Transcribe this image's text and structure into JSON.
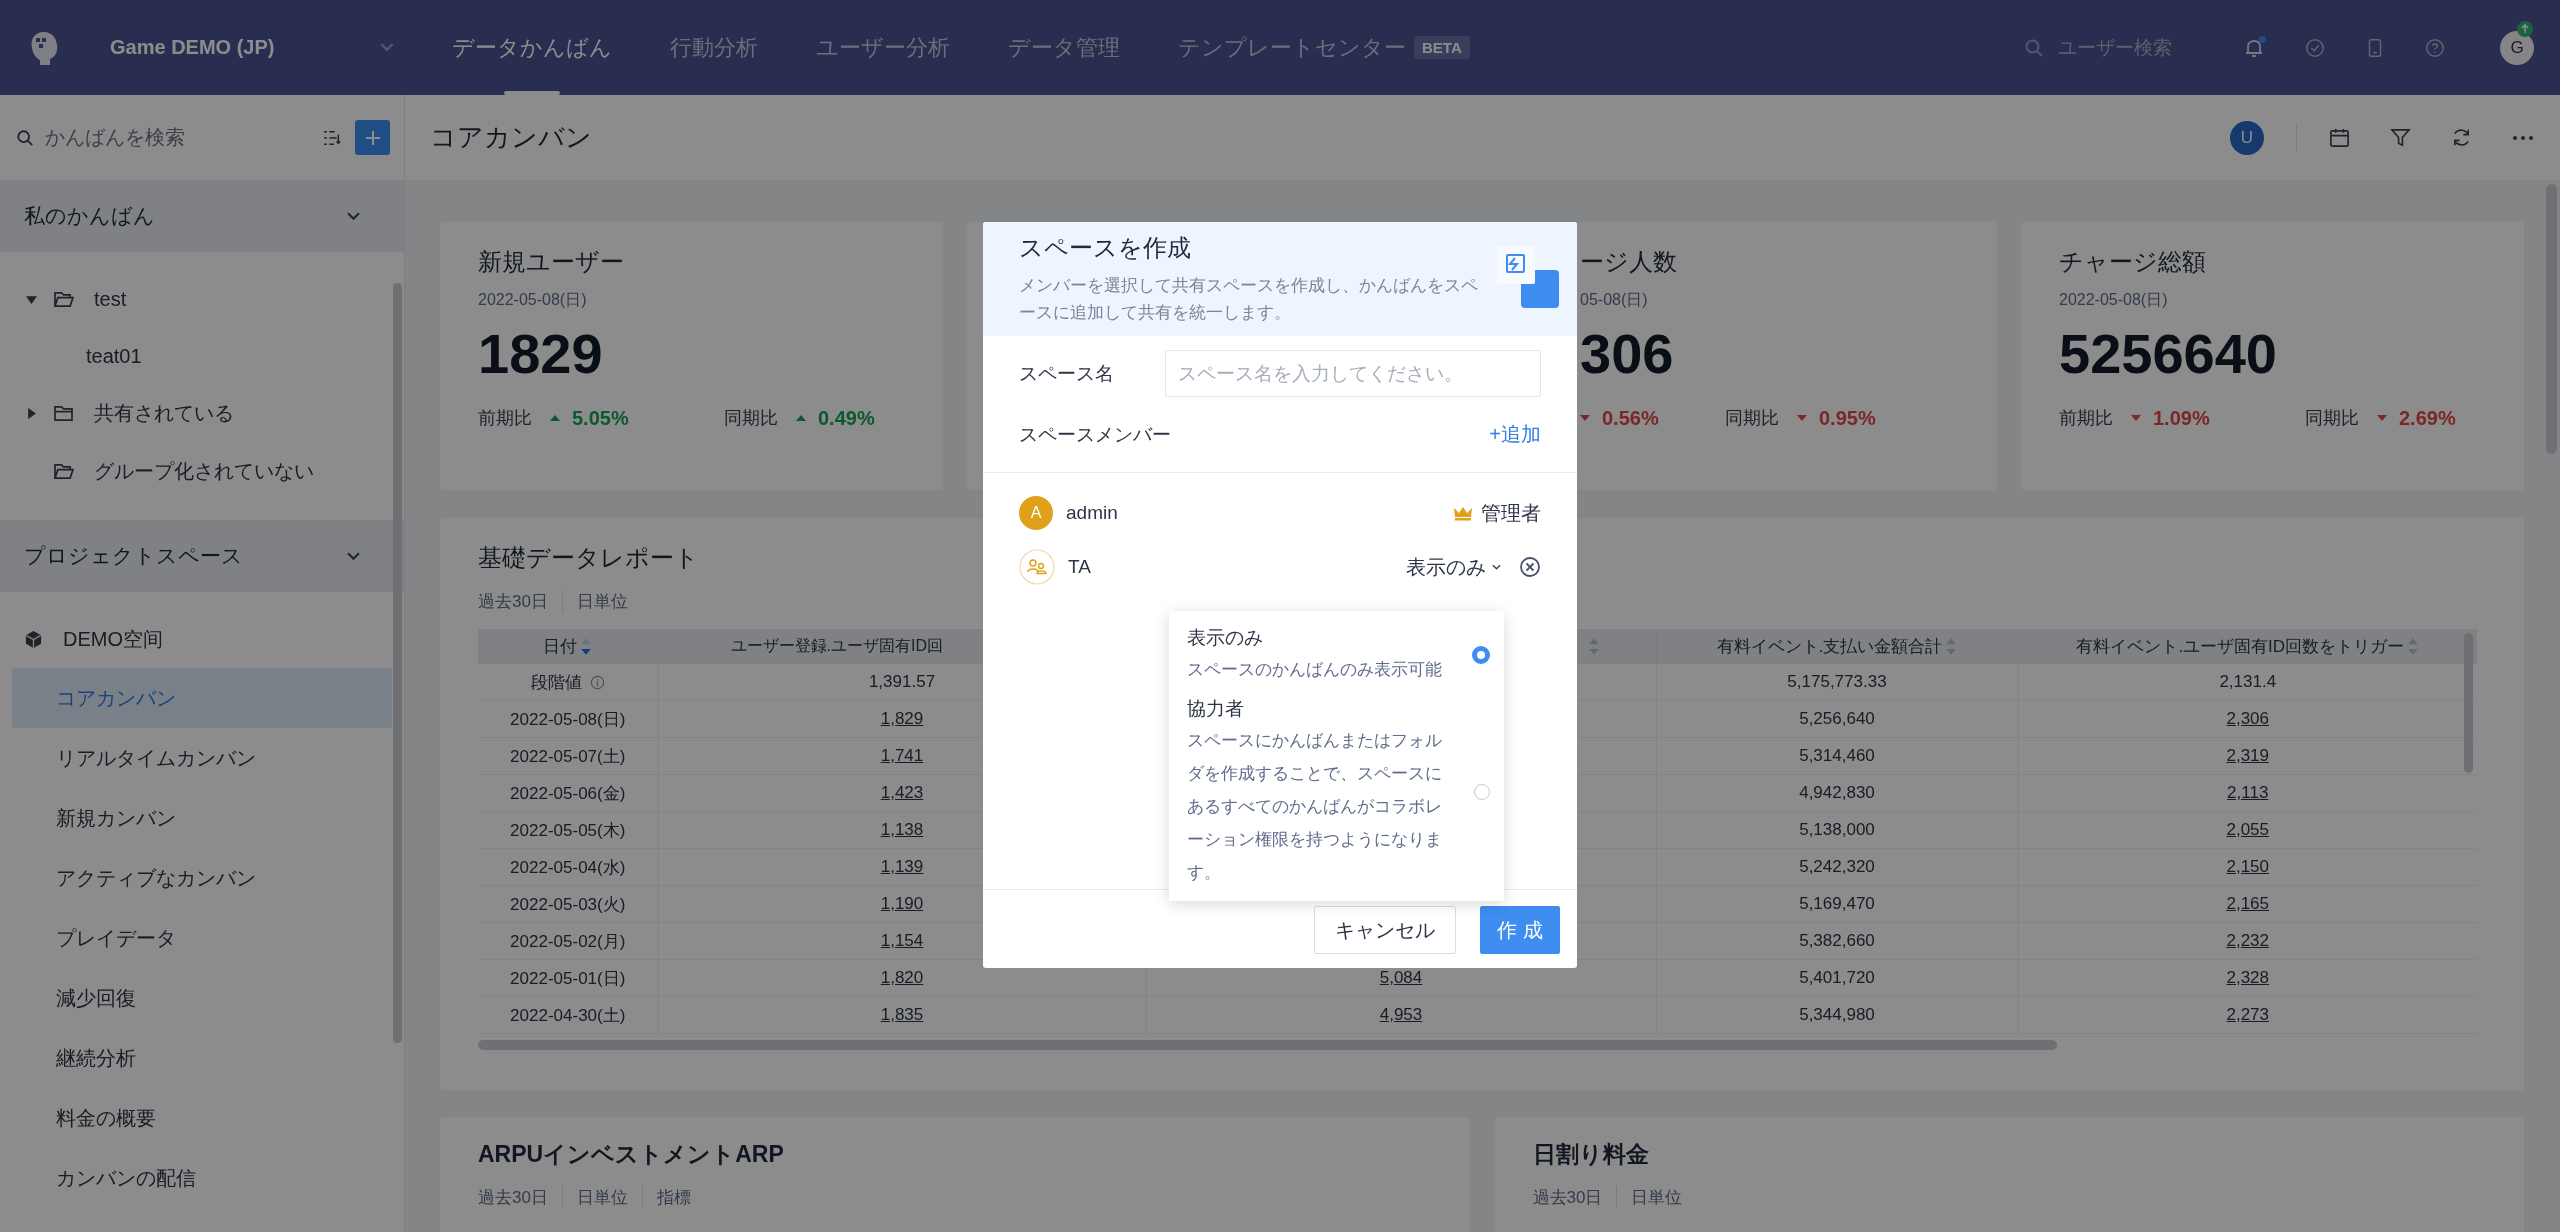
{
  "topbar": {
    "project": "Game DEMO (JP)",
    "nav": [
      {
        "label": "データかんばん",
        "selected": true
      },
      {
        "label": "行動分析",
        "selected": false
      },
      {
        "label": "ユーザー分析",
        "selected": false
      },
      {
        "label": "データ管理",
        "selected": false
      },
      {
        "label": "テンプレートセンター",
        "selected": false,
        "badge": "BETA"
      }
    ],
    "search": {
      "placeholder": "ユーザー検索"
    },
    "notifications_unread": true,
    "avatar": "G"
  },
  "sidebar": {
    "search": {
      "placeholder": "かんばんを検索"
    },
    "sections": [
      {
        "title": "私のかんばん",
        "expanded": true,
        "items": [
          {
            "kind": "folder",
            "label": "test",
            "expanded": true,
            "children": [
              {
                "label": "teat01",
                "selected": false
              }
            ]
          },
          {
            "kind": "folder",
            "label": "共有されている",
            "expanded": false
          },
          {
            "kind": "empty-folder",
            "label": "グループ化されていない"
          }
        ]
      },
      {
        "title": "プロジェクトスペース",
        "expanded": true,
        "items": [
          {
            "kind": "space",
            "label": "DEMO空间",
            "expanded": true,
            "children": [
              {
                "label": "コアカンバン",
                "selected": true
              },
              {
                "label": "リアルタイムカンバン",
                "selected": false
              },
              {
                "label": "新規カンバン",
                "selected": false
              },
              {
                "label": "アクティブなカンバン",
                "selected": false
              },
              {
                "label": "プレイデータ",
                "selected": false
              },
              {
                "label": "減少回復",
                "selected": false
              },
              {
                "label": "継続分析",
                "selected": false
              },
              {
                "label": "料金の概要",
                "selected": false
              },
              {
                "label": "カンバンの配信",
                "selected": false
              }
            ]
          }
        ]
      }
    ]
  },
  "page": {
    "title": "コアカンバン",
    "user_initial": "U"
  },
  "kpi_cards": [
    {
      "kind": "full",
      "title": "新規ユーザー",
      "date": "2022-05-08(日)",
      "value": "1829",
      "stats": [
        {
          "label": "前期比",
          "increase": true,
          "change": "5.05%"
        },
        {
          "label": "同期比",
          "increase": true,
          "change": "0.49%"
        }
      ]
    },
    {
      "kind": "hidden"
    },
    {
      "kind": "partial",
      "title": "ージ人数",
      "date": "05-08(日)",
      "value": "306",
      "stats": [
        {
          "increase": false,
          "change": "0.56%"
        },
        {
          "label": "同期比",
          "increase": false,
          "change": "0.95%"
        }
      ]
    },
    {
      "kind": "full",
      "title": "チャージ総額",
      "date": "2022-05-08(日)",
      "value": "5256640",
      "stats": [
        {
          "label": "前期比",
          "increase": false,
          "change": "1.09%"
        },
        {
          "label": "同期比",
          "increase": false,
          "change": "2.69%"
        }
      ]
    }
  ],
  "report": {
    "title": "基礎データレポート",
    "tags": [
      "過去30日",
      "日単位"
    ],
    "columns": [
      {
        "kind": "date",
        "label": "日付",
        "sorted": true,
        "link": false
      },
      {
        "kind": "cut",
        "label": "ユーザー登録.ユーザ固有ID回",
        "link": true
      },
      {
        "kind": "hidden",
        "sorted": false,
        "link": true
      },
      {
        "kind": "metric",
        "label": "有料イベント.支払い金額合計",
        "sorted": false,
        "link": false
      },
      {
        "kind": "metric",
        "label": "有料イベント.ユーザ固有ID回数をトリガー",
        "sorted": false,
        "link": true
      }
    ],
    "rows": [
      {
        "kind": "summary",
        "cells": [
          "段階値",
          "1,391.57",
          null,
          "5,175,773.33",
          "2,131.4"
        ]
      },
      {
        "kind": "day",
        "cells": [
          "2022-05-08(日)",
          "1,829",
          null,
          "5,256,640",
          "2,306"
        ]
      },
      {
        "kind": "day",
        "cells": [
          "2022-05-07(土)",
          "1,741",
          null,
          "5,314,460",
          "2,319"
        ]
      },
      {
        "kind": "day",
        "cells": [
          "2022-05-06(金)",
          "1,423",
          null,
          "4,942,830",
          "2,113"
        ]
      },
      {
        "kind": "day",
        "cells": [
          "2022-05-05(木)",
          "1,138",
          null,
          "5,138,000",
          "2,055"
        ]
      },
      {
        "kind": "day",
        "cells": [
          "2022-05-04(水)",
          "1,139",
          null,
          "5,242,320",
          "2,150"
        ]
      },
      {
        "kind": "day",
        "cells": [
          "2022-05-03(火)",
          "1,190",
          null,
          "5,169,470",
          "2,165"
        ]
      },
      {
        "kind": "day",
        "cells": [
          "2022-05-02(月)",
          "1,154",
          null,
          "5,382,660",
          "2,232"
        ]
      },
      {
        "kind": "day",
        "cells": [
          "2022-05-01(日)",
          "1,820",
          "5,084",
          "5,401,720",
          "2,328"
        ]
      },
      {
        "kind": "day",
        "cells": [
          "2022-04-30(土)",
          "1,835",
          "4,953",
          "5,344,980",
          "2,273"
        ]
      }
    ]
  },
  "bottom_cards": [
    {
      "title": "ARPUインベストメントARP",
      "tags": [
        "過去30日",
        "日単位",
        "指標"
      ]
    },
    {
      "title": "日割り料金",
      "tags": [
        "過去30日",
        "日単位"
      ]
    }
  ],
  "modal": {
    "title": "スペースを作成",
    "description": "メンバーを選択して共有スペースを作成し、かんばんをスペースに追加して共有を統一します。",
    "name_field": {
      "label": "スペース名",
      "placeholder": "スペース名を入力してください。"
    },
    "members_label": "スペースメンバー",
    "add_link": "+追加",
    "members": [
      {
        "kind": "admin",
        "initial": "A",
        "name": "admin",
        "role": "管理者"
      },
      {
        "kind": "member",
        "name": "TA",
        "role": "表示のみ"
      }
    ],
    "role_menu": {
      "options": [
        {
          "title": "表示のみ",
          "description": "スペースのかんばんのみ表示可能",
          "selected": true
        },
        {
          "title": "協力者",
          "description": "スペースにかんばんまたはフォルダを作成することで、スペースにあるすべてのかんばんがコラボレーション権限を持つようになります。",
          "selected": false
        }
      ]
    },
    "buttons": [
      {
        "kind": "secondary",
        "label": "キャンセル"
      },
      {
        "kind": "primary",
        "label": "作 成"
      }
    ]
  }
}
